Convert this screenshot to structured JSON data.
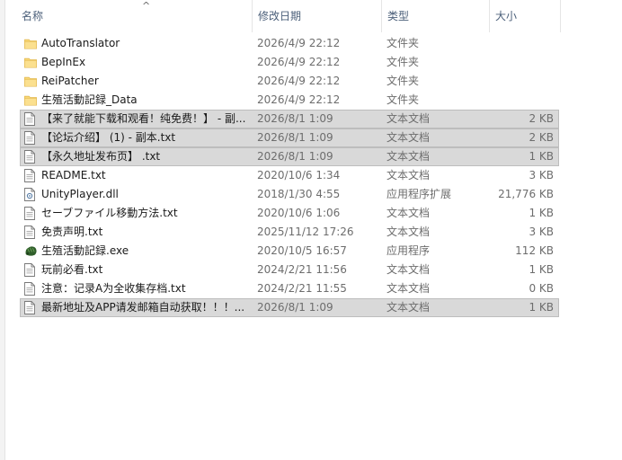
{
  "columns": {
    "name": "名称",
    "date": "修改日期",
    "type": "类型",
    "size": "大小"
  },
  "sort_indicator": "^",
  "files": [
    {
      "name": "AutoTranslator",
      "date": "2026/4/9 22:12",
      "type": "文件夹",
      "size": "",
      "icon": "folder-icon",
      "selected": false
    },
    {
      "name": "BepInEx",
      "date": "2026/4/9 22:12",
      "type": "文件夹",
      "size": "",
      "icon": "folder-icon",
      "selected": false
    },
    {
      "name": "ReiPatcher",
      "date": "2026/4/9 22:12",
      "type": "文件夹",
      "size": "",
      "icon": "folder-icon",
      "selected": false
    },
    {
      "name": "生殖活動記録_Data",
      "date": "2026/4/9 22:12",
      "type": "文件夹",
      "size": "",
      "icon": "folder-icon",
      "selected": false
    },
    {
      "name": "【来了就能下载和观看！纯免费！】 - 副...",
      "date": "2026/8/1 1:09",
      "type": "文本文档",
      "size": "2 KB",
      "icon": "text-file-icon",
      "selected": true
    },
    {
      "name": "【论坛介绍】 (1) - 副本.txt",
      "date": "2026/8/1 1:09",
      "type": "文本文档",
      "size": "2 KB",
      "icon": "text-file-icon",
      "selected": true
    },
    {
      "name": "【永久地址发布页】 .txt",
      "date": "2026/8/1 1:09",
      "type": "文本文档",
      "size": "1 KB",
      "icon": "text-file-icon",
      "selected": true
    },
    {
      "name": "README.txt",
      "date": "2020/10/6 1:34",
      "type": "文本文档",
      "size": "3 KB",
      "icon": "text-file-icon",
      "selected": false
    },
    {
      "name": "UnityPlayer.dll",
      "date": "2018/1/30 4:55",
      "type": "应用程序扩展",
      "size": "21,776 KB",
      "icon": "dll-file-icon",
      "selected": false
    },
    {
      "name": "セーブファイル移動方法.txt",
      "date": "2020/10/6 1:06",
      "type": "文本文档",
      "size": "1 KB",
      "icon": "text-file-icon",
      "selected": false
    },
    {
      "name": "免责声明.txt",
      "date": "2025/11/12 17:26",
      "type": "文本文档",
      "size": "3 KB",
      "icon": "text-file-icon",
      "selected": false
    },
    {
      "name": "生殖活動記録.exe",
      "date": "2020/10/5 16:57",
      "type": "应用程序",
      "size": "112 KB",
      "icon": "exe-app-icon",
      "selected": false
    },
    {
      "name": "玩前必看.txt",
      "date": "2024/2/21 11:56",
      "type": "文本文档",
      "size": "1 KB",
      "icon": "text-file-icon",
      "selected": false
    },
    {
      "name": "注意：记录A为全收集存档.txt",
      "date": "2024/2/21 11:55",
      "type": "文本文档",
      "size": "0 KB",
      "icon": "text-file-icon",
      "selected": false
    },
    {
      "name": "最新地址及APP请发邮箱自动获取！！！...",
      "date": "2026/8/1 1:09",
      "type": "文本文档",
      "size": "1 KB",
      "icon": "text-file-icon",
      "selected": true
    }
  ],
  "colors": {
    "selection": "#d9d9d9",
    "header_text": "#4c607a",
    "folder": "#f8d775"
  }
}
